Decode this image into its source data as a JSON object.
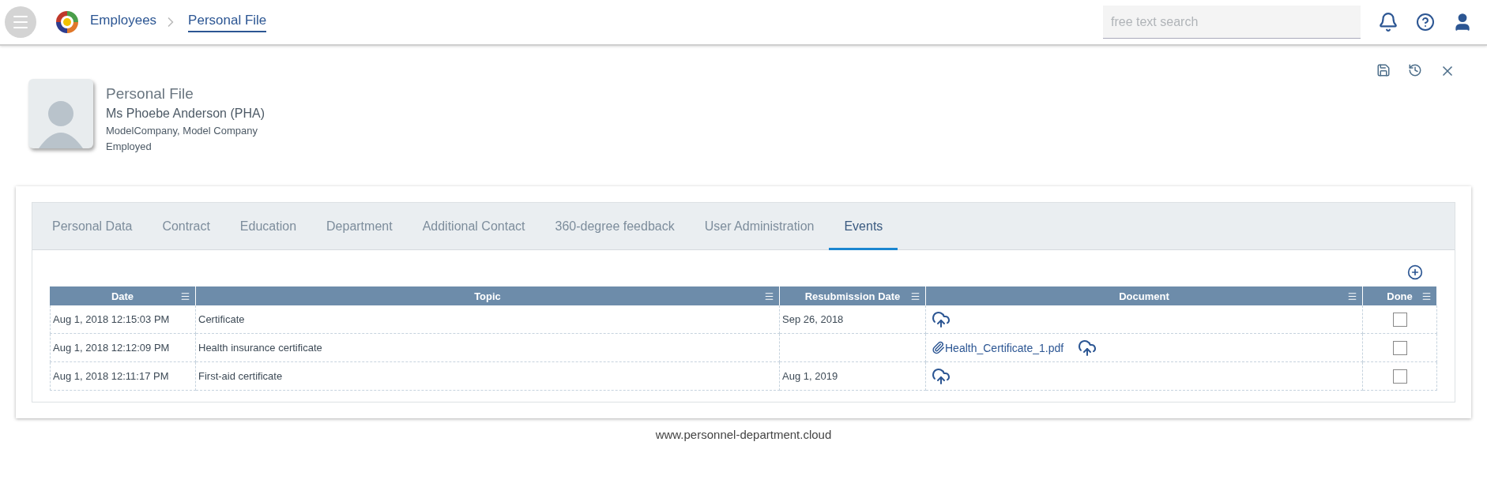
{
  "header": {
    "breadcrumbs": [
      {
        "label": "Employees",
        "selected": false
      },
      {
        "label": "Personal File",
        "selected": true
      }
    ],
    "search": {
      "placeholder": "free text search"
    }
  },
  "profile": {
    "title": "Personal File",
    "name": "Ms Phoebe Anderson (PHA)",
    "company": "ModelCompany, Model Company",
    "status": "Employed"
  },
  "tabs": [
    {
      "label": "Personal Data",
      "selected": false
    },
    {
      "label": "Contract",
      "selected": false
    },
    {
      "label": "Education",
      "selected": false
    },
    {
      "label": "Department",
      "selected": false
    },
    {
      "label": "Additional Contact",
      "selected": false
    },
    {
      "label": "360-degree feedback",
      "selected": false
    },
    {
      "label": "User Administration",
      "selected": false
    },
    {
      "label": "Events",
      "selected": true
    }
  ],
  "table": {
    "columns": [
      "Date",
      "Topic",
      "Resubmission Date",
      "Document",
      "Done"
    ],
    "rows": [
      {
        "date": "Aug 1, 2018 12:15:03 PM",
        "topic": "Certificate",
        "resubmission": "Sep 26, 2018",
        "document": "",
        "done": false
      },
      {
        "date": "Aug 1, 2018 12:12:09 PM",
        "topic": "Health insurance certificate",
        "resubmission": "",
        "document": "Health_Certificate_1.pdf",
        "done": false
      },
      {
        "date": "Aug 1, 2018 12:11:17 PM",
        "topic": "First-aid certificate",
        "resubmission": "Aug 1, 2019",
        "document": "",
        "done": false
      }
    ]
  },
  "footer": "www.personnel-department.cloud"
}
